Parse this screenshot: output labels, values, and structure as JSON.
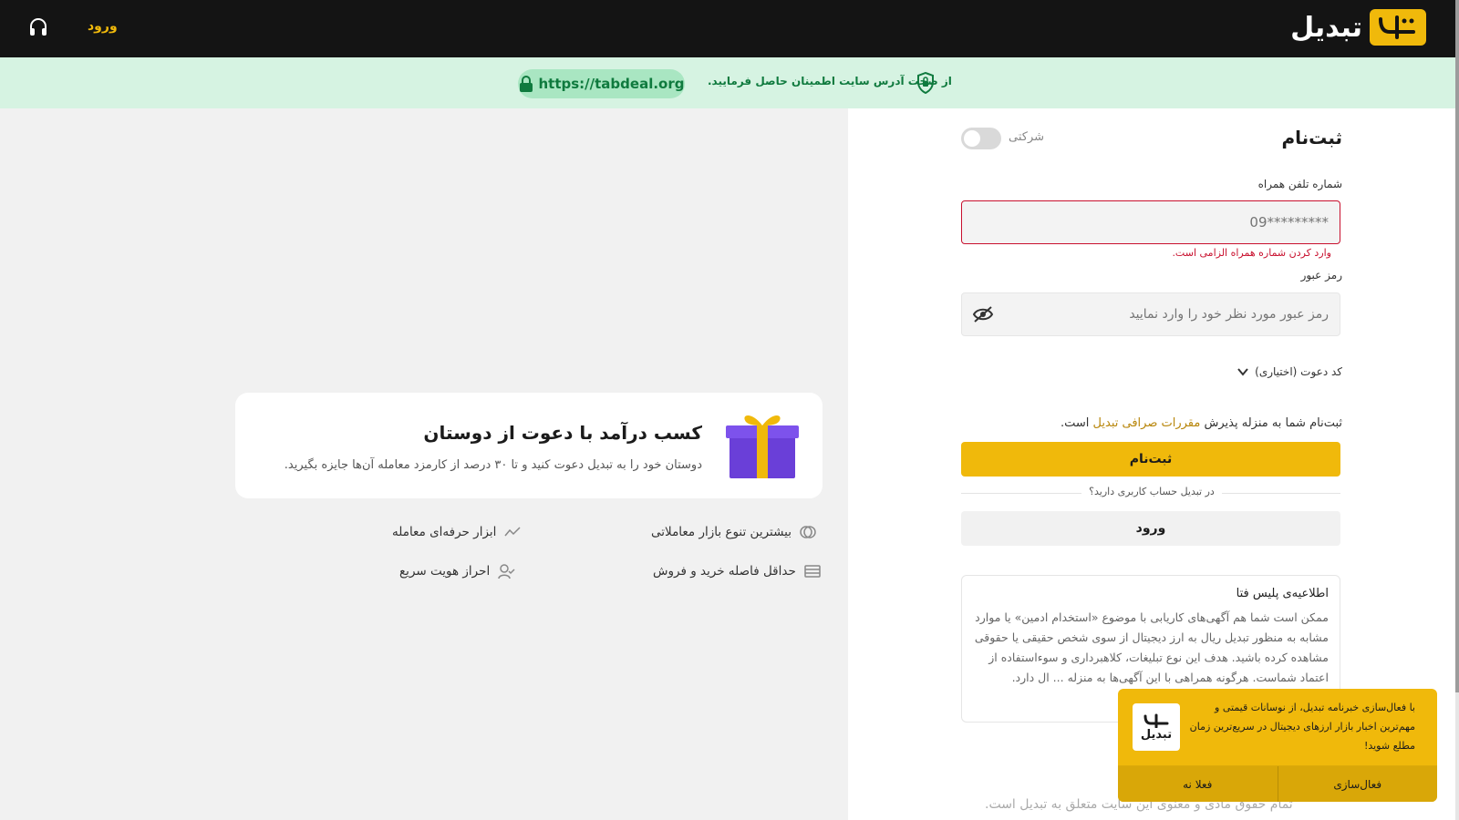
{
  "header": {
    "brand": "تبدیل",
    "login_label": "ورود",
    "support_icon": "headset-icon"
  },
  "security": {
    "message": "از صحت آدرس سایت اطمینان حاصل فرمایید.",
    "url": "https://tabdeal.org"
  },
  "form": {
    "title": "ثبت‌نام",
    "company_toggle_label": "شرکتی",
    "company_toggle_on": false,
    "phone_label": "شماره تلفن همراه",
    "phone_placeholder": "09*********",
    "phone_error": "وارد کردن شماره همراه الزامی است.",
    "password_label": "رمز عبور",
    "password_placeholder": "رمز عبور مورد نظر خود را وارد نمایید",
    "invite_label": "کد دعوت (اختیاری)",
    "terms_prefix": "ثبت‌نام شما به منزله پذیرش",
    "terms_link": "مقررات صرافی تبدیل",
    "terms_suffix": "است.",
    "submit_label": "ثبت‌نام",
    "have_account": "در تبدیل حساب کاربری دارید؟",
    "login_label": "ورود"
  },
  "police_notice": {
    "title": "اطلاعیه‌ی پلیس فتا",
    "body": "ممکن است شما هم آگهی‌های کاریابی با موضوع «استخدام ادمین» یا موارد مشابه به منظور تبدیل ریال به ارز دیجیتال از سوی شخص حقیقی یا حقوقی مشاهده کرده باشید. هدف این نوع تبلیغات، کلاهبرداری و سوءاستفاده از اعتماد شماست. هرگونه همراهی با این آگهی‌ها به منزله ... ال دارد."
  },
  "footer": {
    "copyright": "تمام حقوق مادی و معنوی این سایت متعلق به تبدیل است."
  },
  "referral": {
    "title": "کسب درآمد با دعوت از دوستان",
    "description": "دوستان خود را به تبدیل دعوت کنید و تا ۳۰ درصد از کارمزد معامله آن‌ها جایزه بگیرید."
  },
  "features": [
    {
      "label": "بیشترین تنوع بازار معاملاتی",
      "icon": "coins-icon"
    },
    {
      "label": "ابزار حرفه‌ای معامله",
      "icon": "chart-line-icon"
    },
    {
      "label": "حداقل فاصله خرید و فروش",
      "icon": "card-icon"
    },
    {
      "label": "احراز هویت سریع",
      "icon": "user-check-icon"
    }
  ],
  "newsletter": {
    "logo_text": "تبدیل",
    "message": "با فعال‌سازی خبرنامه تبدیل، از نوسانات قیمتی و مهم‌ترین اخبار بازار ارزهای دیجیتال در سریع‌ترین زمان مطلع شوید!",
    "activate_label": "فعال‌سازی",
    "later_label": "فعلا نه"
  },
  "colors": {
    "brand_yellow": "#f0b90b",
    "header_bg": "#141414",
    "security_bg": "#d6f3e2",
    "security_text": "#0f7a3e",
    "error_red": "#c8102e"
  }
}
